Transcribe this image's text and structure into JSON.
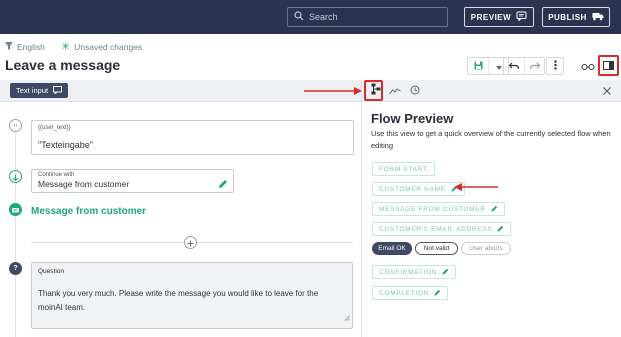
{
  "topbar": {
    "search_placeholder": "Search",
    "preview_label": "PREVIEW",
    "publish_label": "PUBLISH",
    "bg": "#2b3350"
  },
  "meta": {
    "language": "English",
    "status": "Unsaved changes"
  },
  "page": {
    "title": "Leave a message"
  },
  "editor": {
    "chip_label": "Text input",
    "variable_label": "{{user_text}}",
    "variable_value": "\"Texteingabe\"",
    "continue_caption": "Continue with",
    "continue_value": "Message from customer",
    "message_title": "Message from customer",
    "question_caption": "Question",
    "question_text": "Thank you very much. Please write the message you would like to leave for the moinAI team."
  },
  "flow_preview": {
    "title": "Flow Preview",
    "description": "Use this view to get a quick overview of the currently selected flow when editing",
    "steps": [
      {
        "label": "FORM START"
      },
      {
        "label": "CUSTOMER NAME"
      },
      {
        "label": "MESSAGE FROM CUSTOMER"
      },
      {
        "label": "CUSTOMER'S EMAIL ADDRESS"
      },
      {
        "label": "CONFIRMATION"
      },
      {
        "label": "COMPLETION"
      }
    ],
    "tags": [
      "Email OK",
      "Not valid",
      "User aborts"
    ]
  },
  "colors": {
    "accent_green": "#1ea97c",
    "highlight_red": "#d92b2b",
    "chip_dark": "#3e4a63"
  }
}
